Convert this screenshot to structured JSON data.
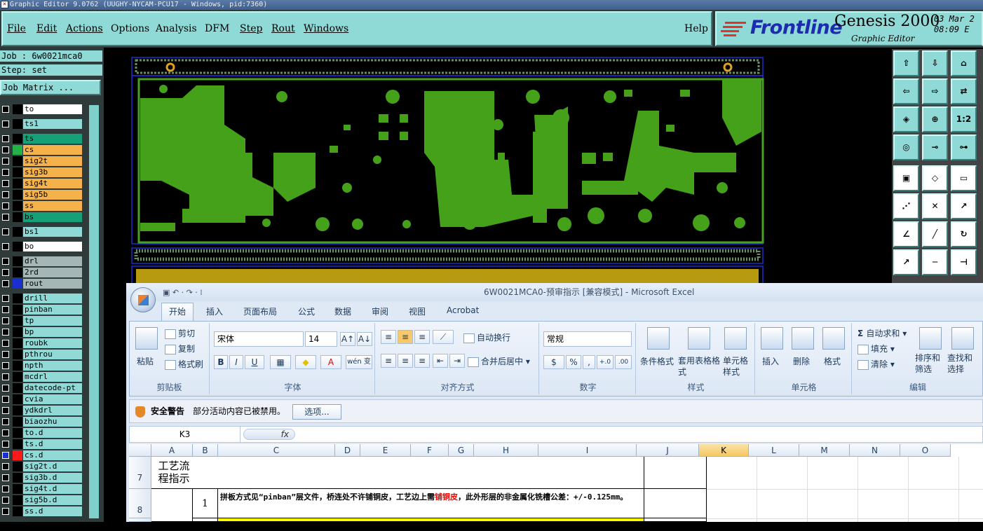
{
  "window": {
    "title": "Graphic Editor 9.0762 (UUGHY-NYCAM-PCU17 - Windows, pid:7360)"
  },
  "menu": {
    "items": [
      "File",
      "Edit",
      "Actions",
      "Options",
      "Analysis",
      "DFM",
      "Step",
      "Rout",
      "Windows"
    ],
    "help": "Help"
  },
  "brand": {
    "logo": "Frontline",
    "product": "Genesis 2000",
    "subtitle": "Graphic Editor",
    "date": "03 Mar 2",
    "time": "08:09 E"
  },
  "job": {
    "job_line": "Job : 6w0021mca0",
    "step_line": "Step: set",
    "matrix_button": "Job Matrix ..."
  },
  "layers": [
    {
      "name": "to",
      "bg": "#ffffff",
      "swatch": "#000000",
      "gap_before": true
    },
    {
      "name": "ts1",
      "bg": "#8fd9d6",
      "swatch": "#000000",
      "gap_before": true
    },
    {
      "name": "ts",
      "bg": "#16a07a",
      "swatch": "#000000",
      "gap_before": true
    },
    {
      "name": "cs",
      "bg": "#f5b24a",
      "swatch": "#23b24a"
    },
    {
      "name": "sig2t",
      "bg": "#f5b24a",
      "swatch": "#000000"
    },
    {
      "name": "sig3b",
      "bg": "#f5b24a",
      "swatch": "#000000"
    },
    {
      "name": "sig4t",
      "bg": "#f5b24a",
      "swatch": "#000000"
    },
    {
      "name": "sig5b",
      "bg": "#f5b24a",
      "swatch": "#000000"
    },
    {
      "name": "ss",
      "bg": "#f5b24a",
      "swatch": "#000000"
    },
    {
      "name": "bs",
      "bg": "#16a07a",
      "swatch": "#000000"
    },
    {
      "name": "bs1",
      "bg": "#8fd9d6",
      "swatch": "#000000",
      "gap_before": true
    },
    {
      "name": "bo",
      "bg": "#ffffff",
      "swatch": "#000000",
      "gap_before": true
    },
    {
      "name": "drl",
      "bg": "#a5b6b6",
      "swatch": "#000000",
      "gap_before": true
    },
    {
      "name": "2rd",
      "bg": "#a5b6b6",
      "swatch": "#000000"
    },
    {
      "name": "rout",
      "bg": "#a5b6b6",
      "swatch": "#1a2fd0"
    },
    {
      "name": "drill",
      "bg": "#8fd9d6",
      "swatch": "#000000",
      "gap_before": true
    },
    {
      "name": "pinban",
      "bg": "#8fd9d6",
      "swatch": "#000000"
    },
    {
      "name": "tp",
      "bg": "#8fd9d6",
      "swatch": "#000000"
    },
    {
      "name": "bp",
      "bg": "#8fd9d6",
      "swatch": "#000000"
    },
    {
      "name": "roubk",
      "bg": "#8fd9d6",
      "swatch": "#000000"
    },
    {
      "name": "pthrou",
      "bg": "#8fd9d6",
      "swatch": "#000000"
    },
    {
      "name": "npth",
      "bg": "#8fd9d6",
      "swatch": "#000000"
    },
    {
      "name": "mcdrl",
      "bg": "#8fd9d6",
      "swatch": "#000000"
    },
    {
      "name": "datecode-pt",
      "bg": "#8fd9d6",
      "swatch": "#000000"
    },
    {
      "name": "cvia",
      "bg": "#8fd9d6",
      "swatch": "#000000"
    },
    {
      "name": "ydkdrl",
      "bg": "#8fd9d6",
      "swatch": "#000000"
    },
    {
      "name": "biaozhu",
      "bg": "#8fd9d6",
      "swatch": "#000000"
    },
    {
      "name": "to.d",
      "bg": "#8fd9d6",
      "swatch": "#000000"
    },
    {
      "name": "ts.d",
      "bg": "#8fd9d6",
      "swatch": "#000000"
    },
    {
      "name": "cs.d",
      "bg": "#8fd9d6",
      "swatch": "#ff1a1a",
      "checked": true
    },
    {
      "name": "sig2t.d",
      "bg": "#8fd9d6",
      "swatch": "#000000"
    },
    {
      "name": "sig3b.d",
      "bg": "#8fd9d6",
      "swatch": "#000000"
    },
    {
      "name": "sig4t.d",
      "bg": "#8fd9d6",
      "swatch": "#000000"
    },
    {
      "name": "sig5b.d",
      "bg": "#8fd9d6",
      "swatch": "#000000"
    },
    {
      "name": "ss.d",
      "bg": "#8fd9d6",
      "swatch": "#000000"
    }
  ],
  "tools": [
    {
      "icon": "move-up-icon",
      "label": "⇧"
    },
    {
      "icon": "move-down-icon",
      "label": "⇩"
    },
    {
      "icon": "home-icon",
      "label": "⌂"
    },
    {
      "icon": "copy-in-icon",
      "label": "⇦"
    },
    {
      "icon": "copy-out-icon",
      "label": "⇨"
    },
    {
      "icon": "swap-icon",
      "label": "⇄"
    },
    {
      "icon": "scale-icon",
      "label": "◈"
    },
    {
      "icon": "fit-icon",
      "label": "⊕"
    },
    {
      "icon": "ratio-icon",
      "label": "1:2"
    },
    {
      "icon": "coin-icon",
      "label": "◎"
    },
    {
      "icon": "connector-icon",
      "label": "⊸"
    },
    {
      "icon": "tree-icon",
      "label": "⊶"
    },
    {
      "icon": "box-icon",
      "label": "▣"
    },
    {
      "icon": "shape-icon",
      "label": "◇"
    },
    {
      "icon": "ruler-icon",
      "label": "▭"
    },
    {
      "icon": "path-icon",
      "label": "⋰"
    },
    {
      "icon": "cross-icon",
      "label": "✕"
    },
    {
      "icon": "link-icon",
      "label": "↗"
    },
    {
      "icon": "angle-icon",
      "label": "∠"
    },
    {
      "icon": "slash-icon",
      "label": "╱"
    },
    {
      "icon": "rotate-icon",
      "label": "↻"
    },
    {
      "icon": "point-icon",
      "label": "↗"
    },
    {
      "icon": "line-icon",
      "label": "─"
    },
    {
      "icon": "measure-icon",
      "label": "⊣"
    }
  ],
  "excel": {
    "quick_access": "▣ ↶ · ↷ · ⁞",
    "title": "6W0021MCA0-预审指示 [兼容模式] - Microsoft Excel",
    "tabs": [
      "开始",
      "插入",
      "页面布局",
      "公式",
      "数据",
      "审阅",
      "视图",
      "Acrobat"
    ],
    "ribbon": {
      "clipboard": {
        "label": "剪贴板",
        "paste": "粘贴",
        "cut": "剪切",
        "copy": "复制",
        "format_painter": "格式刷"
      },
      "font": {
        "label": "字体",
        "name": "宋体",
        "size": "14",
        "bold": "B",
        "italic": "I",
        "underline": "U",
        "wen": "wén 变",
        "grow": "A↑",
        "shrink": "A↓"
      },
      "alignment": {
        "label": "对齐方式",
        "wrap": "自动换行",
        "merge": "合并后居中"
      },
      "number": {
        "label": "数字",
        "format": "常规",
        "currency": "$",
        "percent": "%",
        "comma": ",",
        "inc": "+.0",
        "dec": ".00"
      },
      "styles": {
        "label": "样式",
        "conditional": "条件格式",
        "table": "套用表格格式",
        "cell": "单元格样式"
      },
      "cells": {
        "label": "单元格",
        "insert": "插入",
        "delete": "删除",
        "format": "格式"
      },
      "editing": {
        "label": "编辑",
        "autosum": "自动求和",
        "fill": "填充",
        "clear": "清除",
        "sort": "排序和筛选",
        "find": "查找和选择"
      }
    },
    "security": {
      "label": "安全警告",
      "message": "部分活动内容已被禁用。",
      "options": "选项..."
    },
    "namebox": "K3",
    "fx": "fx",
    "columns": [
      "A",
      "B",
      "C",
      "D",
      "E",
      "F",
      "G",
      "H",
      "I",
      "J",
      "K",
      "L",
      "M",
      "N",
      "O"
    ],
    "rows": {
      "r7": {
        "num": "7",
        "text": "工艺流程指示"
      },
      "r8": {
        "num": "8",
        "b": "1",
        "text_before": "拼板方式见“pinban”层文件，桥连处不许铺铜皮，工艺边上需",
        "text_red": "铺铜皮",
        "text_after": "，此外形层的非金属化铣槽公差：+/-0.125mm。"
      }
    },
    "colors": {
      "accent_red": "#ff0000",
      "highlight_yellow": "#ffff00"
    }
  }
}
